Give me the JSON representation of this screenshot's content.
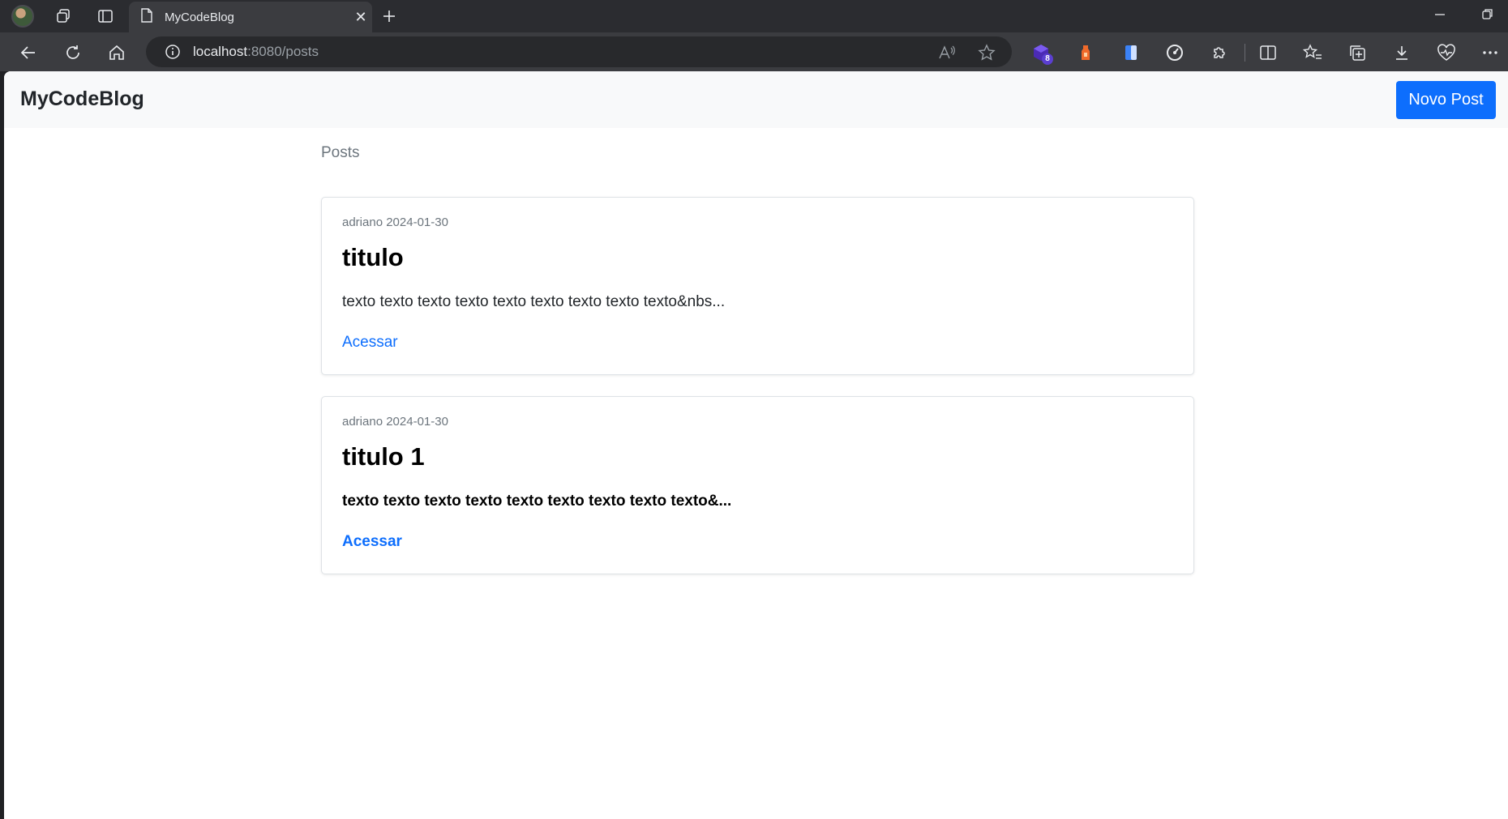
{
  "browser": {
    "tab": {
      "title": "MyCodeBlog"
    },
    "address": {
      "host": "localhost",
      "path": ":8080/posts"
    },
    "extensions": {
      "badge_count": "8"
    }
  },
  "app": {
    "brand": "MyCodeBlog",
    "new_post_label": "Novo Post",
    "posts_heading": "Posts"
  },
  "posts": [
    {
      "meta": "adriano 2024-01-30",
      "title": "titulo",
      "excerpt": "texto texto texto texto texto texto texto texto texto&nbs...",
      "link_label": "Acessar"
    },
    {
      "meta": "adriano 2024-01-30",
      "title": "titulo 1",
      "excerpt": "texto texto texto texto texto texto texto texto texto&...",
      "link_label": "Acessar"
    }
  ],
  "colors": {
    "primary": "#0d6efd",
    "navbar_bg": "#f8f9fa",
    "browser_chrome": "#3b3c40"
  }
}
